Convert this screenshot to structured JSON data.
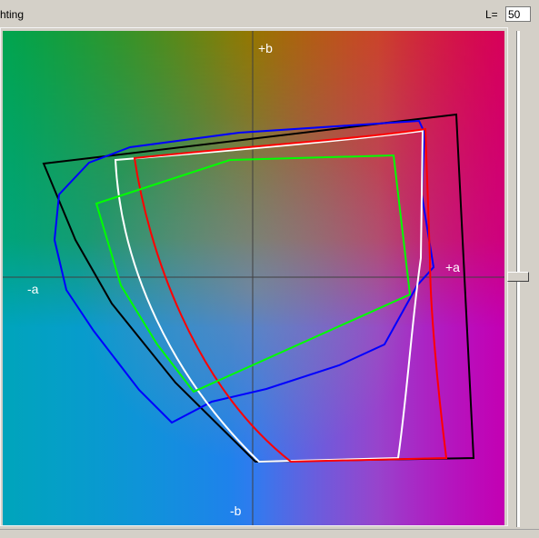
{
  "header": {
    "title_fragment": "hting",
    "lightness_label": "L=",
    "lightness_value": "50"
  },
  "axes": {
    "plus_b": "+b",
    "minus_b": "-b",
    "plus_a": "+a",
    "minus_a": "-a"
  },
  "gamut_outlines": [
    {
      "color": "#000000",
      "shape": "black-outline"
    },
    {
      "color": "#0000ff",
      "shape": "blue-outline"
    },
    {
      "color": "#ffffff",
      "shape": "white-outline"
    },
    {
      "color": "#ff0000",
      "shape": "red-outline"
    },
    {
      "color": "#00ff00",
      "shape": "green-outline"
    }
  ],
  "slider": {
    "name": "lightness-slider"
  }
}
